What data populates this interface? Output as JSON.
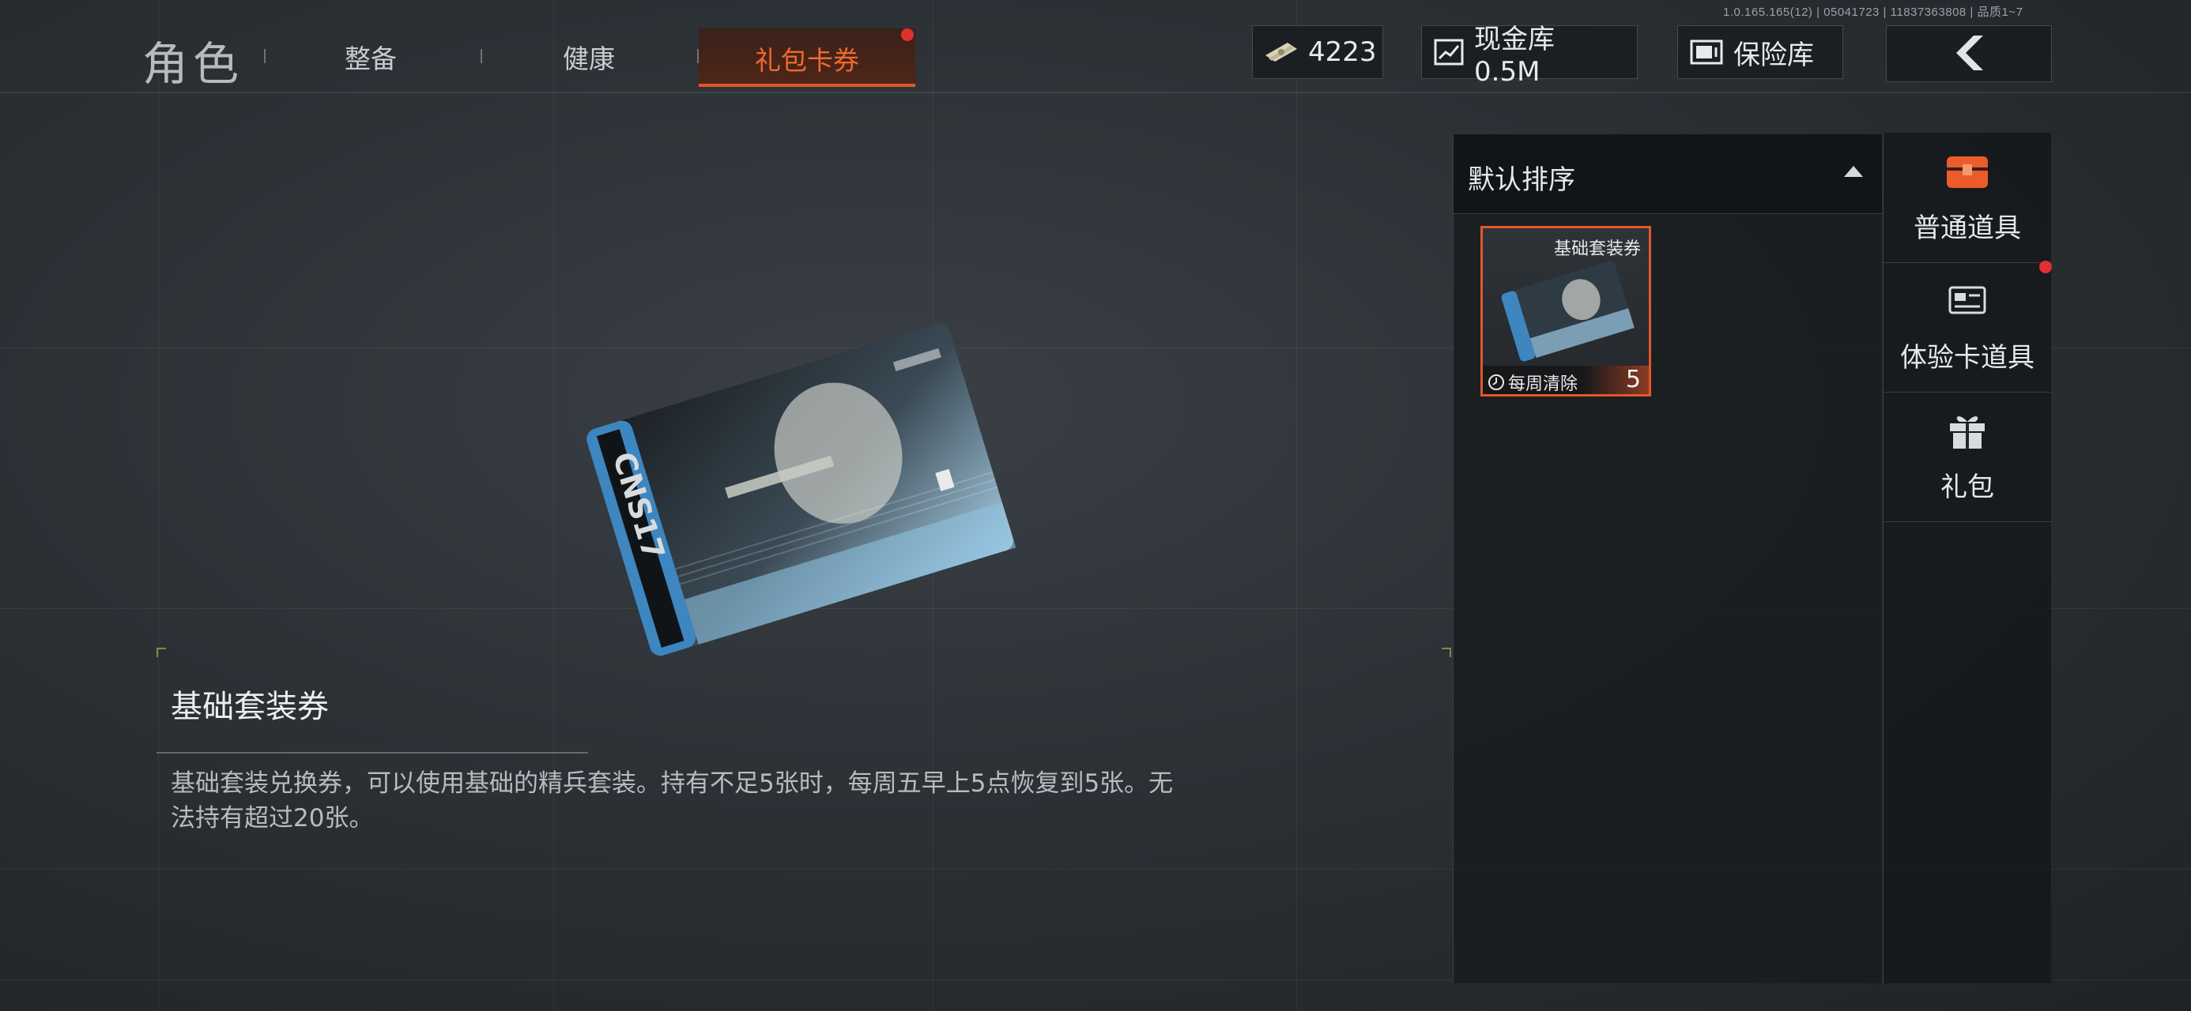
{
  "version_text": "1.0.165.165(12) | 05041723 | 11837363808 | 品质1~7",
  "nav": {
    "title": "角色",
    "tabs": [
      {
        "label": "整备"
      },
      {
        "label": "健康"
      },
      {
        "label": "礼包卡券",
        "active": true,
        "has_notification": true
      }
    ]
  },
  "currency": {
    "coins": "4223",
    "cash_vault_label": "现金库 0.5M",
    "safe_label": "保险库"
  },
  "sort": {
    "label": "默认排序"
  },
  "items": [
    {
      "name": "基础套装券",
      "tag": "每周清除",
      "count": "5",
      "selected": true
    }
  ],
  "categories": [
    {
      "label": "普通道具",
      "icon": "chest-icon",
      "active": true
    },
    {
      "label": "体验卡道具",
      "icon": "card-icon",
      "has_notification": true
    },
    {
      "label": "礼包",
      "icon": "gift-icon"
    }
  ],
  "detail": {
    "title": "基础套装券",
    "description": "基础套装兑换券，可以使用基础的精兵套装。持有不足5张时，每周五早上5点恢复到5张。无法持有超过20张。"
  },
  "colors": {
    "accent": "#e2572a",
    "notification": "#e23030",
    "card_blue": "#3d86c0"
  }
}
